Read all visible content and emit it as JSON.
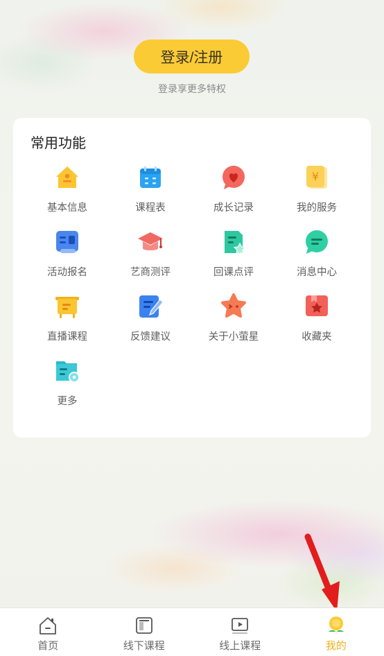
{
  "header": {
    "login_button_label": "登录/注册",
    "login_subtitle": "登录享更多特权"
  },
  "functions": {
    "title": "常用功能",
    "items": [
      {
        "label": "基本信息",
        "icon": "house-icon",
        "color": "#fbc531"
      },
      {
        "label": "课程表",
        "icon": "calendar-icon",
        "color": "#2aa3f2"
      },
      {
        "label": "成长记录",
        "icon": "heart-bubble-icon",
        "color": "#f3675d"
      },
      {
        "label": "我的服务",
        "icon": "yen-ticket-icon",
        "color": "#fbd158"
      },
      {
        "label": "活动报名",
        "icon": "registration-form-icon",
        "color": "#4a86ee"
      },
      {
        "label": "艺商测评",
        "icon": "graduation-cap-icon",
        "color": "#f06a63"
      },
      {
        "label": "回课点评",
        "icon": "review-star-icon",
        "color": "#2ec8a0"
      },
      {
        "label": "消息中心",
        "icon": "chat-bubble-icon",
        "color": "#2ecfa3"
      },
      {
        "label": "直播课程",
        "icon": "easel-icon",
        "color": "#fbc531"
      },
      {
        "label": "反馈建议",
        "icon": "feedback-pen-icon",
        "color": "#3b82f0"
      },
      {
        "label": "关于小萤星",
        "icon": "star-badge-icon",
        "color": "#f57a55"
      },
      {
        "label": "收藏夹",
        "icon": "bookmark-star-icon",
        "color": "#f2605a"
      },
      {
        "label": "更多",
        "icon": "more-settings-icon",
        "color": "#2db8c8"
      }
    ]
  },
  "tabbar": {
    "tabs": [
      {
        "label": "首页",
        "icon": "home-icon"
      },
      {
        "label": "线下课程",
        "icon": "offline-course-icon"
      },
      {
        "label": "线上课程",
        "icon": "online-course-icon"
      },
      {
        "label": "我的",
        "icon": "profile-flower-icon"
      }
    ],
    "active_color": "#f2b21d"
  }
}
